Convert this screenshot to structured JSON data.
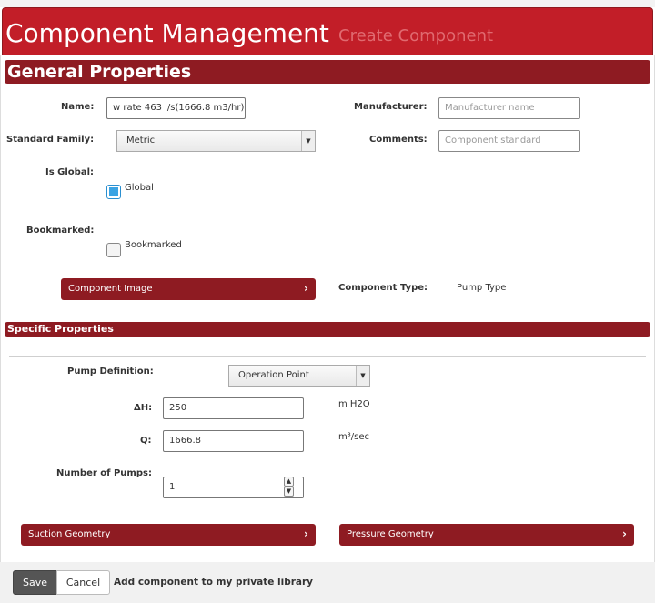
{
  "header": {
    "title": "Component Management",
    "subtitle": "Create Component"
  },
  "general": {
    "section_title": "General Properties",
    "name_label": "Name:",
    "name_value": "w rate 463 l/s(1666.8 m3/hr)",
    "manufacturer_label": "Manufacturer:",
    "manufacturer_placeholder": "Manufacturer name",
    "standard_family_label": "Standard Family:",
    "standard_family_value": "Metric",
    "comments_label": "Comments:",
    "comments_placeholder": "Component standard",
    "is_global_label": "Is Global:",
    "global_checkbox_label": "Global",
    "global_checked": true,
    "bookmarked_label": "Bookmarked:",
    "bookmarked_checkbox_label": "Bookmarked",
    "bookmarked_checked": false,
    "component_image_button": "Component Image",
    "component_type_label": "Component Type:",
    "component_type_value": "Pump Type"
  },
  "specific": {
    "section_title": "Specific Properties",
    "pump_definition_label": "Pump Definition:",
    "pump_definition_value": "Operation Point",
    "dh_label": "ΔH:",
    "dh_value": "250",
    "dh_unit": "m H2O",
    "q_label": "Q:",
    "q_value": "1666.8",
    "q_unit": "m³/sec",
    "num_pumps_label": "Number of Pumps:",
    "num_pumps_value": "1",
    "suction_geometry_button": "Suction Geometry",
    "pressure_geometry_button": "Pressure Geometry"
  },
  "footer": {
    "save_label": "Save",
    "cancel_label": "Cancel",
    "private_library_label": "Add component to my private library"
  },
  "colors": {
    "header_red": "#c21e28",
    "section_red": "#8e1b22",
    "checkbox_blue": "#3aa3e3"
  }
}
